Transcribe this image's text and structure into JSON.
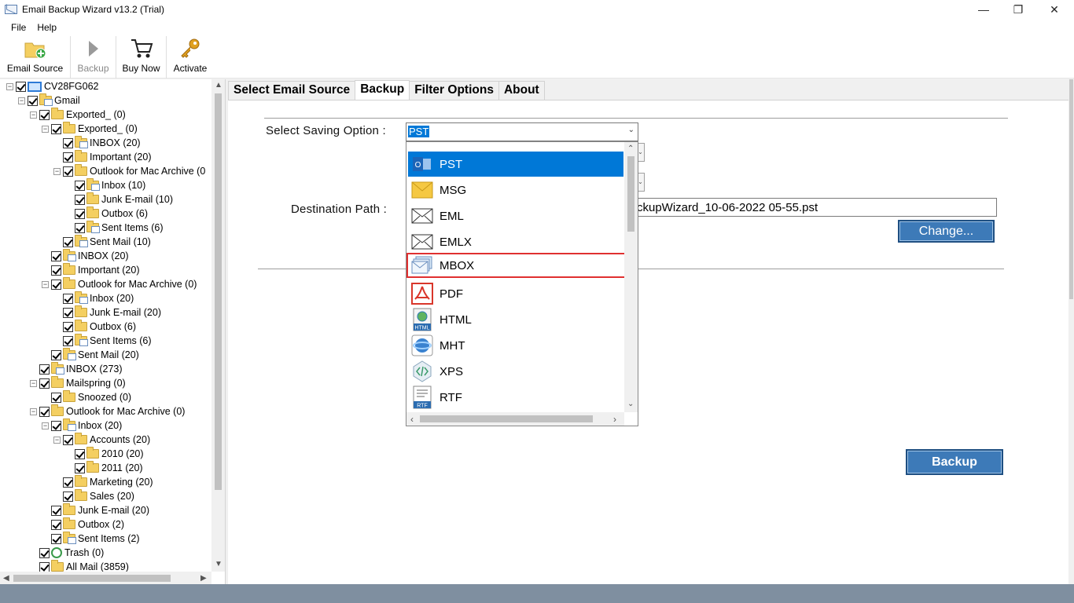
{
  "window": {
    "title": "Email Backup Wizard v13.2 (Trial)",
    "minimize": "—",
    "maximize": "❐",
    "close": "✕"
  },
  "menu": [
    "File",
    "Help"
  ],
  "toolbar": {
    "email_source": "Email Source",
    "backup": "Backup",
    "buy_now": "Buy Now",
    "activate": "Activate"
  },
  "tree": [
    {
      "label": "CV28FG062",
      "level": 0,
      "icon": "computer"
    },
    {
      "label": "Gmail",
      "level": 1,
      "icon": "mail-folder"
    },
    {
      "label": "Exported_ (0)",
      "level": 2,
      "icon": "folder"
    },
    {
      "label": "Exported_ (0)",
      "level": 3,
      "icon": "folder"
    },
    {
      "label": "INBOX (20)",
      "level": 4,
      "icon": "mail-folder"
    },
    {
      "label": "Important (20)",
      "level": 4,
      "icon": "folder"
    },
    {
      "label": "Outlook for Mac Archive (0",
      "level": 4,
      "icon": "folder"
    },
    {
      "label": "Inbox (10)",
      "level": 5,
      "icon": "mail-folder"
    },
    {
      "label": "Junk E-mail (10)",
      "level": 5,
      "icon": "folder"
    },
    {
      "label": "Outbox (6)",
      "level": 5,
      "icon": "folder"
    },
    {
      "label": "Sent Items (6)",
      "level": 5,
      "icon": "mail-folder"
    },
    {
      "label": "Sent Mail (10)",
      "level": 4,
      "icon": "mail-folder"
    },
    {
      "label": "INBOX (20)",
      "level": 3,
      "icon": "mail-folder"
    },
    {
      "label": "Important (20)",
      "level": 3,
      "icon": "folder"
    },
    {
      "label": "Outlook for Mac Archive (0)",
      "level": 3,
      "icon": "folder"
    },
    {
      "label": "Inbox (20)",
      "level": 4,
      "icon": "mail-folder"
    },
    {
      "label": "Junk E-mail (20)",
      "level": 4,
      "icon": "folder"
    },
    {
      "label": "Outbox (6)",
      "level": 4,
      "icon": "folder"
    },
    {
      "label": "Sent Items (6)",
      "level": 4,
      "icon": "mail-folder"
    },
    {
      "label": "Sent Mail (20)",
      "level": 3,
      "icon": "mail-folder"
    },
    {
      "label": "INBOX (273)",
      "level": 2,
      "icon": "mail-folder"
    },
    {
      "label": "Mailspring (0)",
      "level": 2,
      "icon": "folder"
    },
    {
      "label": "Snoozed (0)",
      "level": 3,
      "icon": "folder"
    },
    {
      "label": "Outlook for Mac Archive (0)",
      "level": 2,
      "icon": "folder"
    },
    {
      "label": "Inbox (20)",
      "level": 3,
      "icon": "mail-folder"
    },
    {
      "label": "Accounts (20)",
      "level": 4,
      "icon": "folder"
    },
    {
      "label": "2010 (20)",
      "level": 5,
      "icon": "folder"
    },
    {
      "label": "2011 (20)",
      "level": 5,
      "icon": "folder"
    },
    {
      "label": "Marketing (20)",
      "level": 4,
      "icon": "folder"
    },
    {
      "label": "Sales (20)",
      "level": 4,
      "icon": "folder"
    },
    {
      "label": "Junk E-mail (20)",
      "level": 3,
      "icon": "folder"
    },
    {
      "label": "Outbox (2)",
      "level": 3,
      "icon": "folder"
    },
    {
      "label": "Sent Items (2)",
      "level": 3,
      "icon": "mail-folder"
    },
    {
      "label": "Trash (0)",
      "level": 2,
      "icon": "trash"
    },
    {
      "label": "All Mail (3859)",
      "level": 2,
      "icon": "folder"
    }
  ],
  "tabs": [
    "Select Email Source",
    "Backup",
    "Filter Options",
    "About"
  ],
  "active_tab": "Backup",
  "form": {
    "saving_option_label": "Select Saving Option :",
    "saving_option_value": "PST",
    "destination_label": "Destination Path :",
    "destination_value": "ckupWizard_10-06-2022 05-55.pst",
    "change_button": "Change...",
    "backup_button": "Backup"
  },
  "dropdown": {
    "items": [
      {
        "label": "PST",
        "icon": "outlook-pst-icon"
      },
      {
        "label": "MSG",
        "icon": "envelope-yellow-icon"
      },
      {
        "label": "EML",
        "icon": "envelope-icon"
      },
      {
        "label": "EMLX",
        "icon": "envelope-icon"
      },
      {
        "label": "MBOX",
        "icon": "mbox-icon"
      },
      {
        "label": "PDF",
        "icon": "pdf-icon"
      },
      {
        "label": "HTML",
        "icon": "html-icon"
      },
      {
        "label": "MHT",
        "icon": "mht-icon"
      },
      {
        "label": "XPS",
        "icon": "xps-icon"
      },
      {
        "label": "RTF",
        "icon": "rtf-icon"
      }
    ],
    "selected": "PST",
    "highlighted": "MBOX"
  },
  "colors": {
    "selection": "#0078d7",
    "button_blue": "#3d7ab8",
    "highlight_outline": "#e03030"
  }
}
